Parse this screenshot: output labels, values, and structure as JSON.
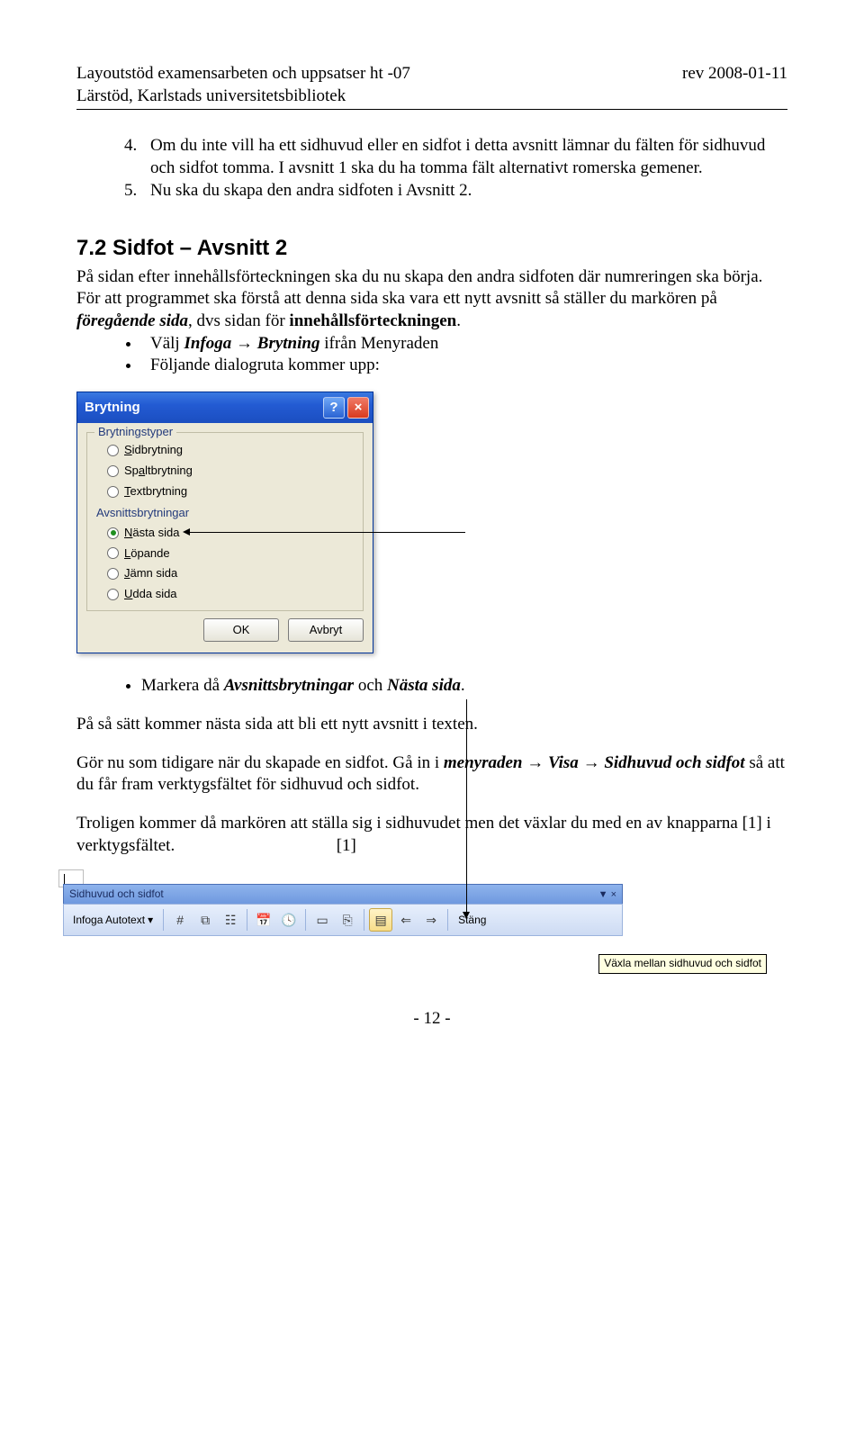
{
  "header": {
    "left_line1": "Layoutstöd examensarbeten och uppsatser ht -07",
    "right_line1": "rev 2008-01-11",
    "left_line2": "Lärstöd, Karlstads universitetsbibliotek"
  },
  "ordered": {
    "start": 4,
    "items": [
      "Om du inte vill ha ett sidhuvud eller en sidfot i detta avsnitt lämnar du fälten för sidhuvud och sidfot tomma. I avsnitt 1 ska du ha tomma fält alternativt romerska gemener.",
      "Nu ska du skapa den andra sidfoten i Avsnitt 2."
    ]
  },
  "section": {
    "title": "7.2 Sidfot – Avsnitt 2",
    "p1_plain": "På sidan efter innehållsförteckningen ska du nu skapa den andra sidfoten där numreringen ska börja. För att programmet ska förstå att denna sida ska vara ett nytt avsnitt så ställer du markören på ",
    "p1_em1": "föregående sida",
    "p1_mid": ", dvs sidan för ",
    "p1_strong": "innehållsförteckningen",
    "p1_end": "."
  },
  "bullets1": {
    "b1_pre": "Välj ",
    "b1_em1": "Infoga",
    "b1_arrow": "→",
    "b1_em2": "Brytning",
    "b1_post": " ifrån Menyraden",
    "b2": "Följande dialogruta kommer upp:"
  },
  "dialog": {
    "title": "Brytning",
    "help": "?",
    "close": "×",
    "group1_title": "Brytningstyper",
    "r1": "Sidbrytning",
    "r2": "Spaltbrytning",
    "r3": "Textbrytning",
    "group2_title": "Avsnittsbrytningar",
    "r4": "Nästa sida",
    "r5": "Löpande",
    "r6": "Jämn sida",
    "r7": "Udda sida",
    "ok": "OK",
    "cancel": "Avbryt"
  },
  "bullets2": {
    "b1_pre": "Markera då ",
    "b1_em1": "Avsnittsbrytningar",
    "b1_mid": " och ",
    "b1_em2": "Nästa sida",
    "b1_end": "."
  },
  "p2": "På så sätt kommer nästa sida att bli ett nytt avsnitt i texten.",
  "p3": {
    "t1": "Gör nu som tidigare när du skapade en sidfot. Gå in i ",
    "s1": "menyraden",
    "arrow": "→",
    "s2": "Visa",
    "s3": "Sidhuvud och sidfot",
    "t2": " så att du får fram verktygsfältet för sidhuvud och sidfot."
  },
  "p4": {
    "t1": "Troligen kommer då markören att ställa sig i sidhuvudet men det växlar du med en av knapparna [1] i verktygsfältet.",
    "ref": "[1]"
  },
  "toolbar": {
    "title": "Sidhuvud och sidfot",
    "dropdown": "Infoga Autotext",
    "close": "Stäng",
    "tooltip": "Växla mellan sidhuvud och sidfot"
  },
  "icons": {
    "pagehash": "#",
    "pageplus": "⧉",
    "pagecnt": "☷",
    "calendar": "📅",
    "clock": "🕓",
    "page_setup": "▭",
    "link": "⎘",
    "toggle": "▤",
    "prev": "⇐",
    "next": "⇒"
  },
  "pagenum": "- 12 -"
}
